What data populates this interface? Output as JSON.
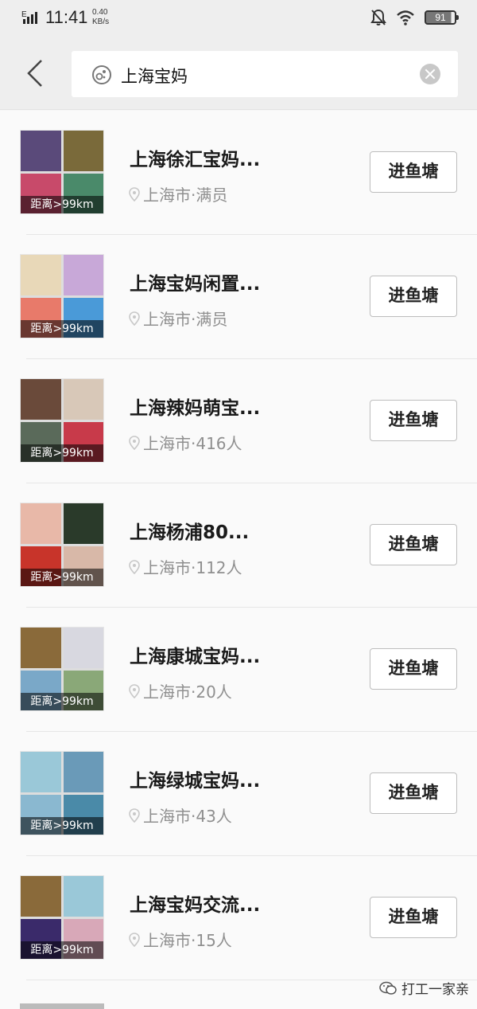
{
  "status_bar": {
    "network": "E",
    "time": "11:41",
    "speed_value": "0.40",
    "speed_unit": "KB/s",
    "battery": "91"
  },
  "search": {
    "query": "上海宝妈",
    "icons": {
      "back": "chevron-left-icon",
      "search": "search-icon",
      "clear": "clear-icon"
    }
  },
  "results": [
    {
      "name": "上海徐汇宝妈...",
      "location": "上海市·满员",
      "distance": "距离>99km",
      "button": "进鱼塘",
      "thumb_colors": [
        "#5a4a7a",
        "#7a6a3a",
        "#c84a6a",
        "#4a8a6a"
      ]
    },
    {
      "name": "上海宝妈闲置...",
      "location": "上海市·满员",
      "distance": "距离>99km",
      "button": "进鱼塘",
      "thumb_colors": [
        "#e8d8b8",
        "#c8a8d8",
        "#e87a6a",
        "#4a9ad8"
      ]
    },
    {
      "name": "上海辣妈萌宝...",
      "location": "上海市·416人",
      "distance": "距离>99km",
      "button": "进鱼塘",
      "thumb_colors": [
        "#6a4a3a",
        "#d8c8b8",
        "#5a6a5a",
        "#c83a4a"
      ]
    },
    {
      "name": "上海杨浦80...",
      "location": "上海市·112人",
      "distance": "距离>99km",
      "button": "进鱼塘",
      "thumb_colors": [
        "#e8b8a8",
        "#2a3a2a",
        "#c8342a",
        "#d8b8a8"
      ]
    },
    {
      "name": "上海康城宝妈...",
      "location": "上海市·20人",
      "distance": "距离>99km",
      "button": "进鱼塘",
      "thumb_colors": [
        "#8a6a3a",
        "#d8d8e0",
        "#7aa8c8",
        "#8aa878"
      ]
    },
    {
      "name": "上海绿城宝妈...",
      "location": "上海市·43人",
      "distance": "距离>99km",
      "button": "进鱼塘",
      "thumb_colors": [
        "#9ac8d8",
        "#6a9ab8",
        "#8ab8d0",
        "#4a8aa8"
      ]
    },
    {
      "name": "上海宝妈交流...",
      "location": "上海市·15人",
      "distance": "距离>99km",
      "button": "进鱼塘",
      "thumb_colors": [
        "#8a6a3a",
        "#9ac8d8",
        "#3a2a6a",
        "#d8a8b8"
      ]
    }
  ],
  "watermark": {
    "text": "打工一家亲",
    "icon": "wechat-icon"
  },
  "colors": {
    "background": "#f6f6f6",
    "header": "#eeeeee",
    "muted_text": "#8f8f8f"
  }
}
